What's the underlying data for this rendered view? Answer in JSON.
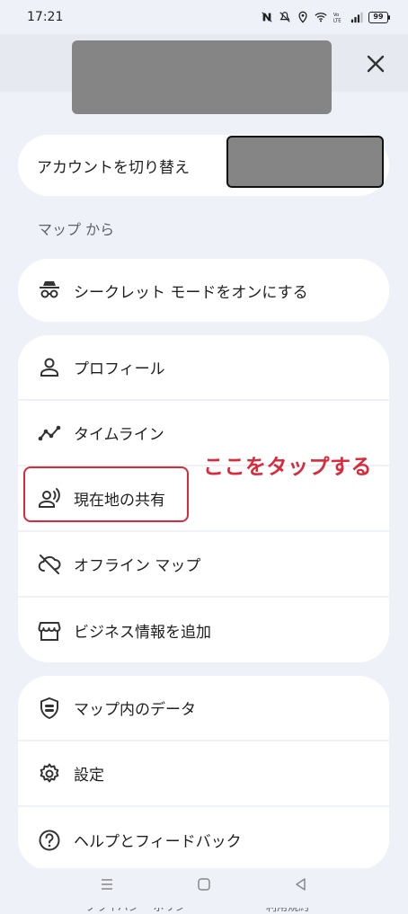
{
  "status_bar": {
    "time": "17:21",
    "icons": [
      "nfc-icon",
      "mute-icon",
      "location-icon",
      "wifi-icon",
      "volte-icon",
      "signal-icon"
    ],
    "battery": "99"
  },
  "header": {
    "close_icon": "close-icon"
  },
  "account": {
    "switch_label": "アカウントを切り替え"
  },
  "section": {
    "title": "マップ から"
  },
  "incognito": {
    "label": "シークレット モードをオンにする",
    "icon": "incognito-icon"
  },
  "menu_group_1": [
    {
      "label": "プロフィール",
      "icon": "person-icon"
    },
    {
      "label": "タイムライン",
      "icon": "timeline-icon"
    },
    {
      "label": "現在地の共有",
      "icon": "location-sharing-icon"
    },
    {
      "label": "オフライン マップ",
      "icon": "offline-map-icon"
    },
    {
      "label": "ビジネス情報を追加",
      "icon": "storefront-icon"
    }
  ],
  "menu_group_2": [
    {
      "label": "マップ内のデータ",
      "icon": "shield-data-icon"
    },
    {
      "label": "設定",
      "icon": "settings-icon"
    },
    {
      "label": "ヘルプとフィードバック",
      "icon": "help-icon"
    }
  ],
  "annotation": {
    "text": "ここをタップする",
    "color": "#d9293a"
  },
  "footer": {
    "privacy": "プライバシー ポリシー",
    "terms": "利用規約"
  },
  "nav": {
    "icons": [
      "recents-icon",
      "home-icon",
      "back-icon"
    ]
  }
}
